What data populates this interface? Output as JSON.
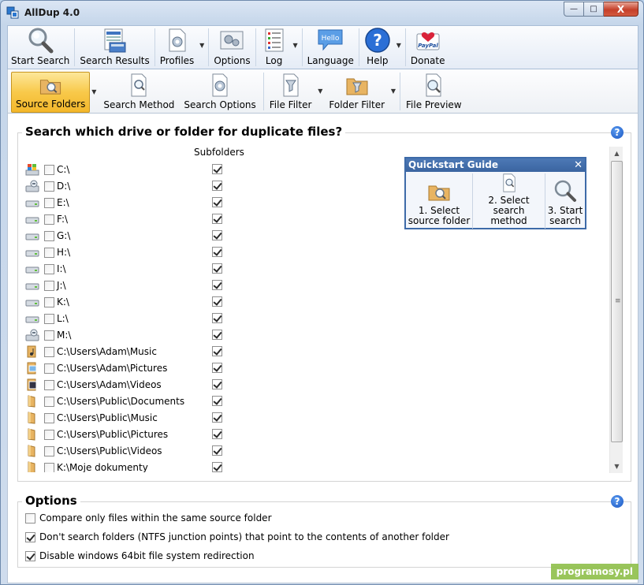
{
  "window": {
    "title": "AllDup 4.0",
    "minimize": "—",
    "maximize": "□",
    "close": "X"
  },
  "toolbar_main": [
    {
      "label": "Start Search",
      "icon": "magnifier-icon"
    },
    {
      "label": "Search Results",
      "icon": "results-icon"
    },
    {
      "label": "Profiles",
      "icon": "profiles-icon",
      "dropdown": true
    },
    {
      "label": "Options",
      "icon": "options-icon"
    },
    {
      "label": "Log",
      "icon": "log-icon",
      "dropdown": true
    },
    {
      "label": "Language",
      "icon": "language-icon",
      "icon_text": "Hello"
    },
    {
      "label": "Help",
      "icon": "help-icon",
      "dropdown": true
    },
    {
      "label": "Donate",
      "icon": "paypal-icon",
      "icon_text": "PayPal"
    }
  ],
  "toolbar_secondary": [
    {
      "label": "Source Folders",
      "active": true,
      "dropdown": true
    },
    {
      "label": "Search Method"
    },
    {
      "label": "Search Options"
    },
    {
      "label": "File Filter",
      "dropdown": true
    },
    {
      "label": "Folder Filter",
      "dropdown": true
    },
    {
      "label": "File Preview"
    }
  ],
  "search_panel": {
    "title": "Search which drive or folder for duplicate files?",
    "subfolders_header": "Subfolders",
    "help_symbol": "?",
    "drives": [
      {
        "path": "C:\\",
        "icon": "windows-drive-icon",
        "checked": false,
        "subfolders": true
      },
      {
        "path": "D:\\",
        "icon": "removable-drive-icon",
        "checked": false,
        "subfolders": true
      },
      {
        "path": "E:\\",
        "icon": "hard-drive-icon",
        "checked": false,
        "subfolders": true
      },
      {
        "path": "F:\\",
        "icon": "hard-drive-icon",
        "checked": false,
        "subfolders": true
      },
      {
        "path": "G:\\",
        "icon": "hard-drive-icon",
        "checked": false,
        "subfolders": true
      },
      {
        "path": "H:\\",
        "icon": "hard-drive-icon",
        "checked": false,
        "subfolders": true
      },
      {
        "path": "I:\\",
        "icon": "hard-drive-icon",
        "checked": false,
        "subfolders": true
      },
      {
        "path": "J:\\",
        "icon": "hard-drive-icon",
        "checked": false,
        "subfolders": true
      },
      {
        "path": "K:\\",
        "icon": "hard-drive-icon",
        "checked": false,
        "subfolders": true
      },
      {
        "path": "L:\\",
        "icon": "hard-drive-icon",
        "checked": false,
        "subfolders": true
      },
      {
        "path": "M:\\",
        "icon": "removable-drive-icon",
        "checked": false,
        "subfolders": true
      },
      {
        "path": "C:\\Users\\Adam\\Music",
        "icon": "music-folder-icon",
        "checked": false,
        "subfolders": true
      },
      {
        "path": "C:\\Users\\Adam\\Pictures",
        "icon": "pictures-folder-icon",
        "checked": false,
        "subfolders": true
      },
      {
        "path": "C:\\Users\\Adam\\Videos",
        "icon": "videos-folder-icon",
        "checked": false,
        "subfolders": true
      },
      {
        "path": "C:\\Users\\Public\\Documents",
        "icon": "folder-icon",
        "checked": false,
        "subfolders": true
      },
      {
        "path": "C:\\Users\\Public\\Music",
        "icon": "folder-icon",
        "checked": false,
        "subfolders": true
      },
      {
        "path": "C:\\Users\\Public\\Pictures",
        "icon": "folder-icon",
        "checked": false,
        "subfolders": true
      },
      {
        "path": "C:\\Users\\Public\\Videos",
        "icon": "folder-icon",
        "checked": false,
        "subfolders": true
      },
      {
        "path": "K:\\Moje dokumenty",
        "icon": "folder-icon",
        "checked": false,
        "subfolders": true
      }
    ]
  },
  "quickstart": {
    "title": "Quickstart Guide",
    "close": "✕",
    "steps": [
      {
        "line1": "1. Select",
        "line2": "source folder"
      },
      {
        "line1": "2. Select",
        "line2": "search method"
      },
      {
        "line1": "3. Start",
        "line2": "search"
      }
    ]
  },
  "options_panel": {
    "title": "Options",
    "help_symbol": "?",
    "items": [
      {
        "label": "Compare only files within the same source folder",
        "checked": false
      },
      {
        "label": "Don't search folders (NTFS junction points) that point to the contents of another folder",
        "checked": true
      },
      {
        "label": "Disable windows 64bit file system redirection",
        "checked": true
      }
    ]
  },
  "watermark": "programosy.pl",
  "colors": {
    "active_tab": "#f8c94a",
    "quickstart_header": "#3a64a0",
    "help_blue": "#1a56c2"
  }
}
